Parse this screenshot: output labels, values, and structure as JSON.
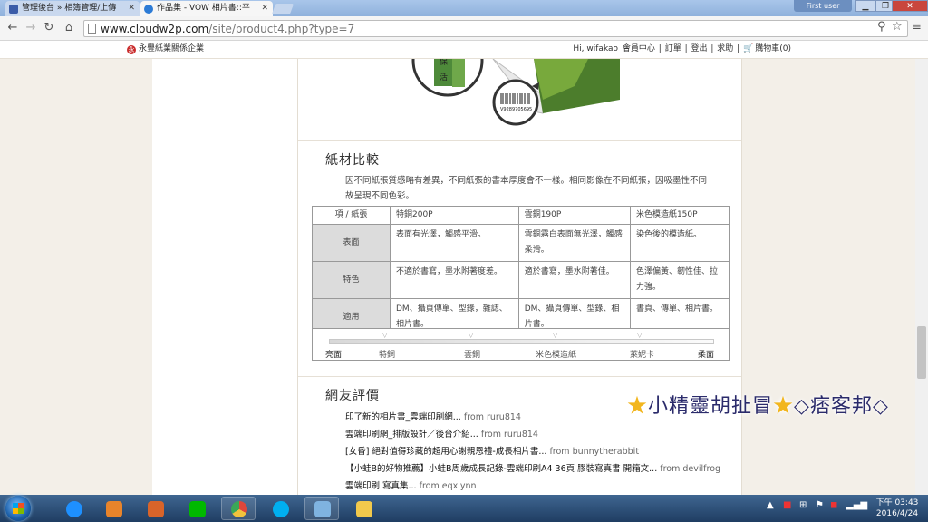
{
  "browser": {
    "tabs": [
      {
        "label": "管理後台 » 相簿管理/上傳",
        "active": false
      },
      {
        "label": "作品集 - VOW 相片書::平",
        "active": true
      }
    ],
    "user_tag": "First user",
    "url_host": "www.cloudw2p.com",
    "url_path": "/site/product4.php?type=7"
  },
  "site": {
    "brand": "永豐紙業關係企業",
    "brand_mark": "永",
    "usernav": {
      "greeting": "Hi, wifakao",
      "member": "會員中心",
      "orders": "訂單",
      "logout": "登出",
      "help": "求助",
      "cart": "購物車(0)"
    }
  },
  "illustration": {
    "lens_text_1": "保",
    "lens_text_2": "活",
    "barcode_number": "V9289705695"
  },
  "paper_compare": {
    "title": "紙材比較",
    "description": "因不同紙張質感略有差異，不同紙張的書本厚度會不一樣。相同影像在不同紙張，因吸墨性不同故呈現不同色彩。",
    "headers": [
      "項 / 紙張",
      "特銅200P",
      "雲銅190P",
      "米色模造紙150P"
    ],
    "rows": [
      {
        "label": "表面",
        "cells": [
          "表面有光澤，觸感平滑。",
          "雲銅霧白表面無光澤，觸感柔滑。",
          "染色後的模造紙。"
        ]
      },
      {
        "label": "特色",
        "cells": [
          "不適於書寫，墨水附著度差。",
          "適於書寫，墨水附著佳。",
          "色澤偏黃、韌性佳、拉力強。"
        ]
      },
      {
        "label": "適用",
        "cells": [
          "DM、攝頁傳單、型錄，雜誌、相片書。",
          "DM、攝頁傳單、型錄、相片書。",
          "書頁、傳單、相片書。"
        ]
      }
    ],
    "scale_labels": [
      "亮面",
      "特銅",
      "雲銅",
      "米色模造紙",
      "萊妮卡",
      "柔面"
    ]
  },
  "reviews": {
    "title": "網友評價",
    "items": [
      {
        "title": "印了新的相片書_雲端印刷網...",
        "from": "from ruru814"
      },
      {
        "title": "雲端印刷網_排版設計／後台介紹...",
        "from": "from ruru814"
      },
      {
        "title": "[女昏] 絕對值得珍藏的超用心謝親恩禮-成長相片書...",
        "from": "from bunnytherabbit"
      },
      {
        "title": "【小蛙B的好物推薦】小蛙B周歲成長記錄-雲端印刷A4 36頁 膠裝寫真書 開箱文...",
        "from": "from devilfrog"
      },
      {
        "title": "雲端印刷 寫真集...",
        "from": "from eqxlynn"
      }
    ]
  },
  "watermark": {
    "star": "★",
    "text1": "小精靈胡扯冒",
    "text2": "◇痞客邦◇"
  },
  "taskbar": {
    "time": "下午 03:43",
    "date": "2016/4/24",
    "colors": {
      "ie": "#1e90ff",
      "media": "#e8842b",
      "store": "#d8642a",
      "line": "#00b900",
      "chrome": "#e0463a",
      "skype": "#00aff0",
      "paint": "#7fb3e0",
      "folder": "#f2c94c"
    }
  }
}
